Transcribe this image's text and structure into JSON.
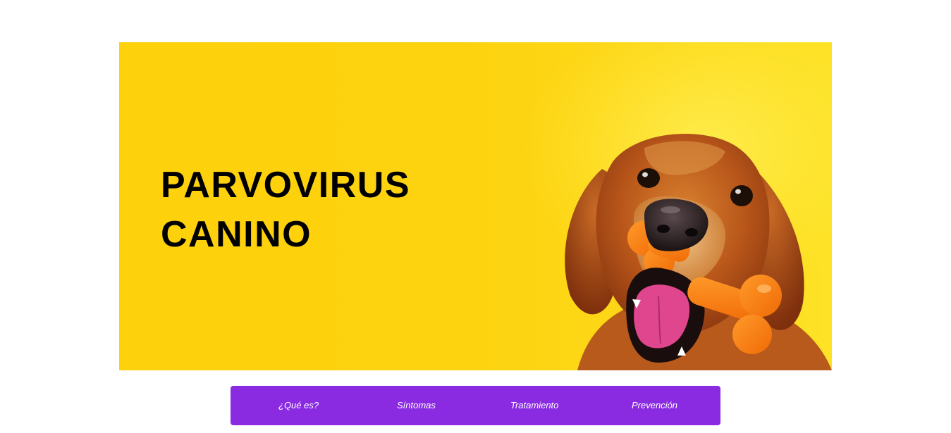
{
  "hero": {
    "title_line1": "PARVOVIRUS",
    "title_line2": "CANINO",
    "background_color": "#fdd20e",
    "image": "golden-retriever-with-orange-bone"
  },
  "nav": {
    "background_color": "#8a2be2",
    "items": [
      {
        "label": "¿Qué es?"
      },
      {
        "label": "Síntomas"
      },
      {
        "label": "Tratamiento"
      },
      {
        "label": "Prevención"
      }
    ]
  }
}
